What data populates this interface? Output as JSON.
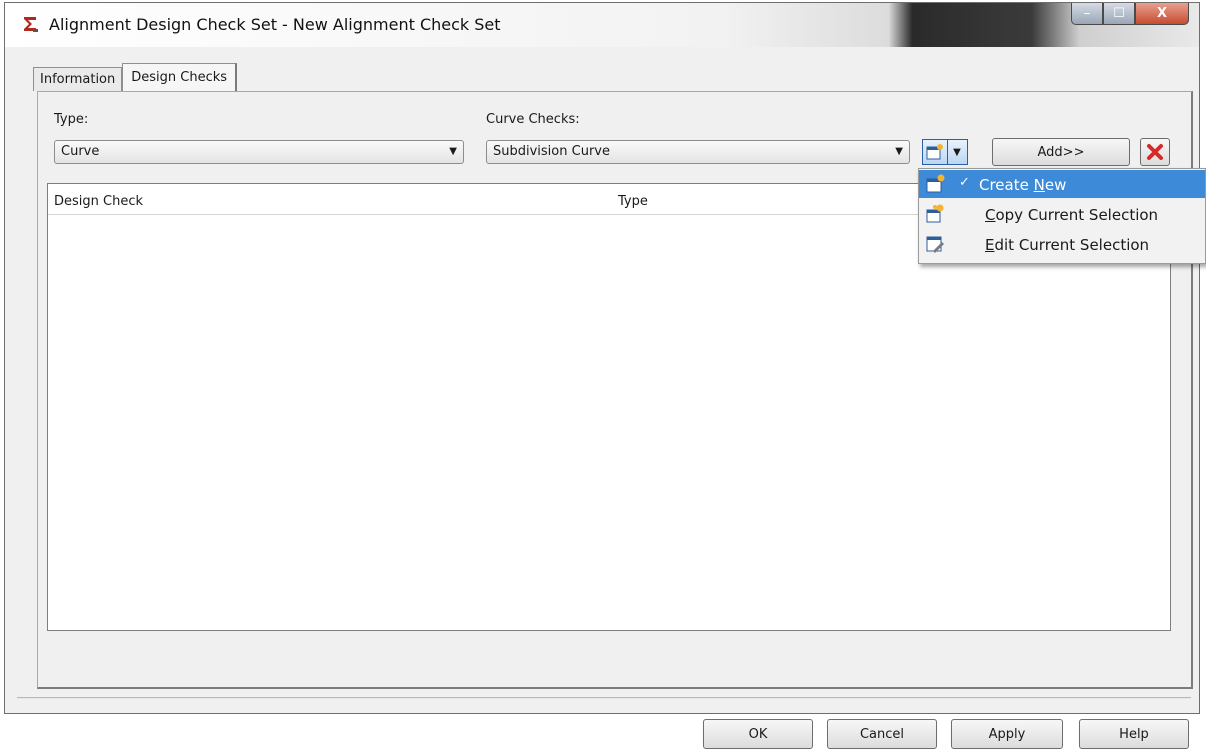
{
  "window": {
    "title": "Alignment Design Check Set - New Alignment Check Set",
    "controls": {
      "minimize": "–",
      "maximize": "☐",
      "close": "X"
    }
  },
  "tabs": [
    {
      "label": "Information",
      "active": false
    },
    {
      "label": "Design Checks",
      "active": true
    }
  ],
  "type_field": {
    "label": "Type:",
    "value": "Curve"
  },
  "curve_checks_field": {
    "label": "Curve Checks:",
    "value": "Subdivision Curve"
  },
  "add_button": {
    "label": "Add>>"
  },
  "list": {
    "columns": [
      "Design Check",
      "Type"
    ],
    "rows": []
  },
  "dropdown_menu": {
    "items": [
      {
        "label_pre": "Create ",
        "label_underlined": "N",
        "label_post": "ew",
        "checked": true,
        "highlighted": true,
        "icon": "create-new-icon"
      },
      {
        "label_pre": "",
        "label_underlined": "C",
        "label_post": "opy Current Selection",
        "checked": false,
        "highlighted": false,
        "icon": "copy-icon"
      },
      {
        "label_pre": "",
        "label_underlined": "E",
        "label_post": "dit Current Selection",
        "checked": false,
        "highlighted": false,
        "icon": "edit-icon"
      }
    ],
    "check_glyph": "✓"
  },
  "footer_buttons": {
    "ok": "OK",
    "cancel": "Cancel",
    "apply": "Apply",
    "help": "Help"
  },
  "colors": {
    "menu_highlight": "#3d8ad8",
    "delete_red": "#d42a2a"
  }
}
